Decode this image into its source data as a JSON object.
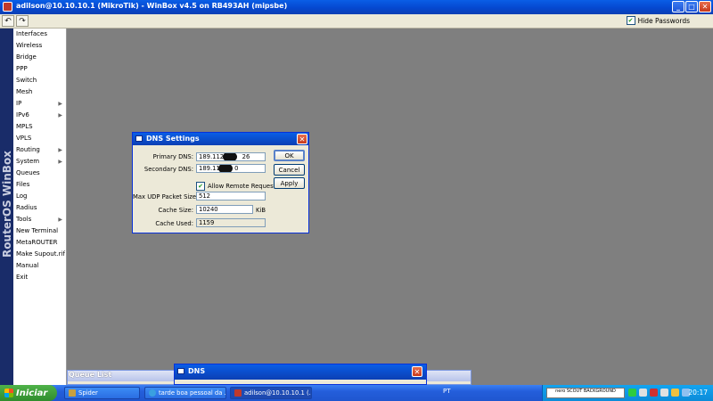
{
  "window": {
    "title": "adilson@10.10.10.1 (MikroTik) - WinBox v4.5 on RB493AH (mipsbe)"
  },
  "toolbar": {
    "undo": "↶",
    "redo": "↷",
    "hide_passwords": "Hide Passwords",
    "hide_passwords_checked": true
  },
  "sidebar": {
    "brand": "RouterOS WinBox",
    "items": [
      {
        "label": "Interfaces",
        "sub": false
      },
      {
        "label": "Wireless",
        "sub": false
      },
      {
        "label": "Bridge",
        "sub": false
      },
      {
        "label": "PPP",
        "sub": false
      },
      {
        "label": "Switch",
        "sub": false
      },
      {
        "label": "Mesh",
        "sub": false
      },
      {
        "label": "IP",
        "sub": true
      },
      {
        "label": "IPv6",
        "sub": true
      },
      {
        "label": "MPLS",
        "sub": false
      },
      {
        "label": "VPLS",
        "sub": false
      },
      {
        "label": "Routing",
        "sub": true
      },
      {
        "label": "System",
        "sub": true
      },
      {
        "label": "Queues",
        "sub": false
      },
      {
        "label": "Files",
        "sub": false
      },
      {
        "label": "Log",
        "sub": false
      },
      {
        "label": "Radius",
        "sub": false
      },
      {
        "label": "Tools",
        "sub": true
      },
      {
        "label": "New Terminal",
        "sub": false
      },
      {
        "label": "MetaROUTER",
        "sub": false
      },
      {
        "label": "Make Supout.rif",
        "sub": false
      },
      {
        "label": "Manual",
        "sub": false
      },
      {
        "label": "Exit",
        "sub": false
      }
    ]
  },
  "dns_dialog": {
    "title": "DNS Settings",
    "primary_label": "Primary DNS:",
    "primary_value": "189.112.",
    "primary_suffix": "26",
    "secondary_label": "Secondary DNS:",
    "secondary_value": "189.11",
    "secondary_suffix": "0",
    "allow_remote_label": "Allow Remote Requests",
    "allow_remote_checked": true,
    "udp_label": "Max UDP Packet Size:",
    "udp_value": "512",
    "cache_size_label": "Cache Size:",
    "cache_size_value": "10240",
    "cache_size_unit": "KiB",
    "cache_used_label": "Cache Used:",
    "cache_used_value": "1159",
    "ok": "OK",
    "cancel": "Cancel",
    "apply": "Apply"
  },
  "queue_window": {
    "title": "Queue List"
  },
  "dns_mini": {
    "title": "DNS"
  },
  "taskbar": {
    "start": "Iniciar",
    "tasks": [
      "Spider",
      "tarde boa pessoal da ...",
      "adilson@10.10.10.1 (..."
    ],
    "lang": "PT",
    "nero": "nero SCOUT BACKGROUND",
    "clock": "20:17"
  }
}
